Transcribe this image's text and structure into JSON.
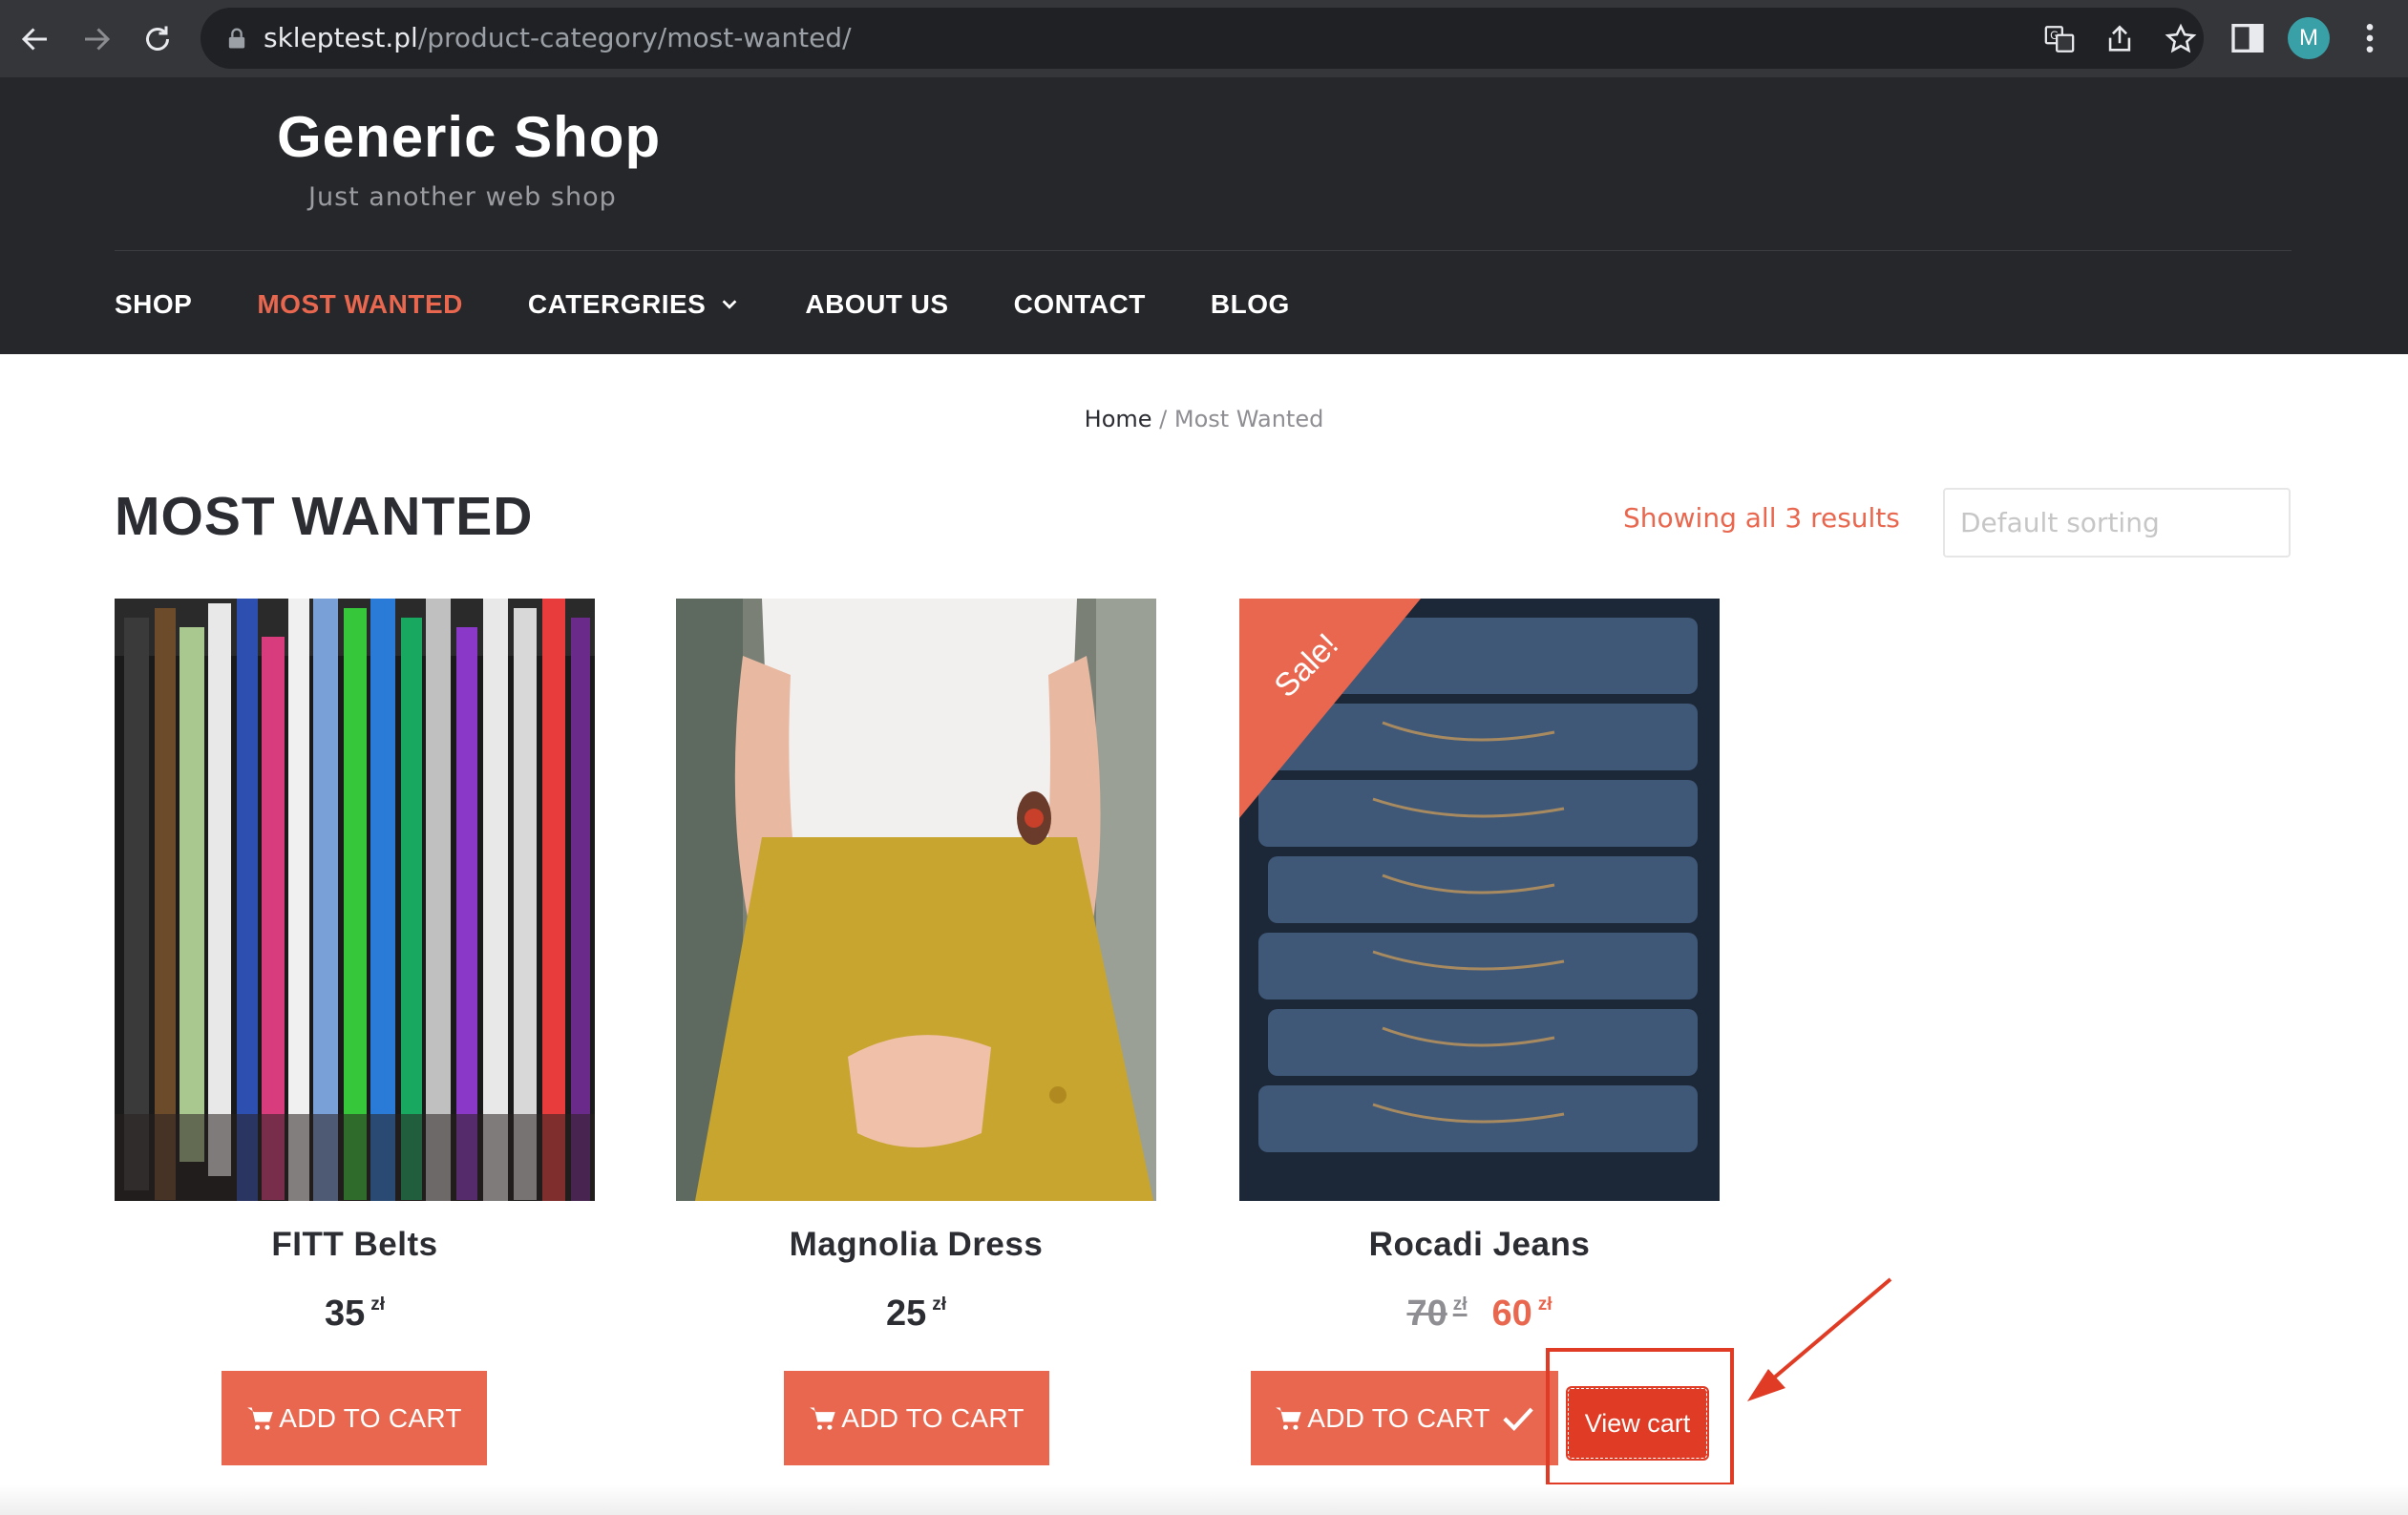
{
  "browser": {
    "url_host": "skleptest.pl",
    "url_path": "/product-category/most-wanted/",
    "profile_initial": "M"
  },
  "site": {
    "title": "Generic Shop",
    "tagline": "Just another web shop"
  },
  "nav": {
    "items": [
      {
        "label": "SHOP",
        "active": false
      },
      {
        "label": "MOST WANTED",
        "active": true
      },
      {
        "label": "CATERGRIES",
        "active": false,
        "has_dropdown": true
      },
      {
        "label": "ABOUT US",
        "active": false
      },
      {
        "label": "CONTACT",
        "active": false
      },
      {
        "label": "BLOG",
        "active": false
      }
    ]
  },
  "breadcrumb": {
    "home": "Home",
    "separator": " / ",
    "current": "Most Wanted"
  },
  "page": {
    "title": "MOST WANTED",
    "result_count": "Showing all 3 results",
    "sorting_placeholder": "Default sorting"
  },
  "products": [
    {
      "name": "FITT Belts",
      "price": "35",
      "currency": "zł",
      "button": "ADD TO CART"
    },
    {
      "name": "Magnolia Dress",
      "price": "25",
      "currency": "zł",
      "button": "ADD TO CART"
    },
    {
      "name": "Rocadi Jeans",
      "price_old": "70",
      "price": "60",
      "currency": "zł",
      "sale_badge": "Sale!",
      "button": "ADD TO CART",
      "added": true
    }
  ],
  "view_cart": "View cart",
  "colors": {
    "accent": "#e8674e",
    "header_bg": "#26272b",
    "annotation": "#e03b24"
  }
}
